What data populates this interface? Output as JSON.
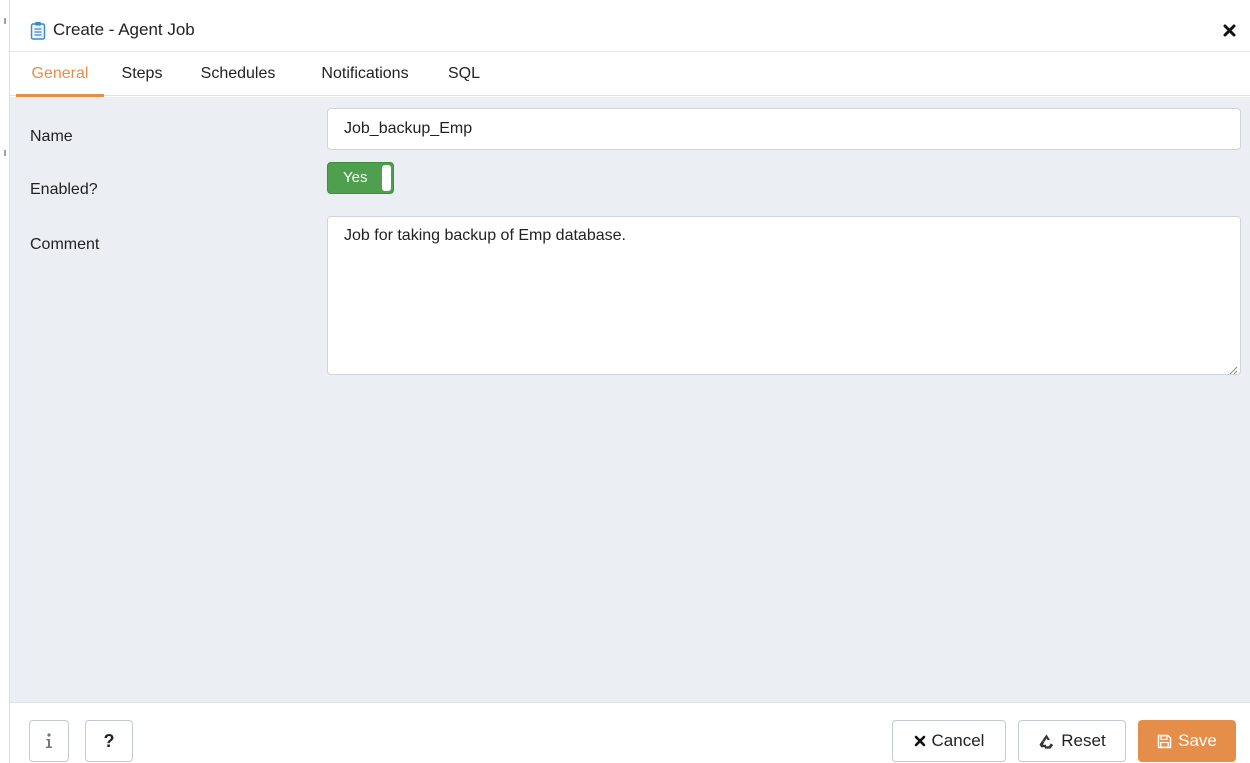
{
  "dialog": {
    "title": "Create - Agent Job",
    "icons": {
      "title": "clipboard-icon",
      "close": "close-icon"
    }
  },
  "tabs": [
    {
      "label": "General",
      "active": true
    },
    {
      "label": "Steps",
      "active": false
    },
    {
      "label": "Schedules",
      "active": false
    },
    {
      "label": "Notifications",
      "active": false
    },
    {
      "label": "SQL",
      "active": false
    }
  ],
  "form": {
    "name_label": "Name",
    "name_value": "Job_backup_Emp",
    "enabled_label": "Enabled?",
    "enabled_value": "Yes",
    "comment_label": "Comment",
    "comment_value": "Job for taking backup of Emp database."
  },
  "footer": {
    "info_icon": "info-icon",
    "help_label": "?",
    "cancel_label": "Cancel",
    "reset_label": "Reset",
    "save_label": "Save"
  },
  "colors": {
    "accent": "#e58e4a",
    "toggle_on": "#4e9f4e",
    "content_bg": "#ebeef3"
  }
}
